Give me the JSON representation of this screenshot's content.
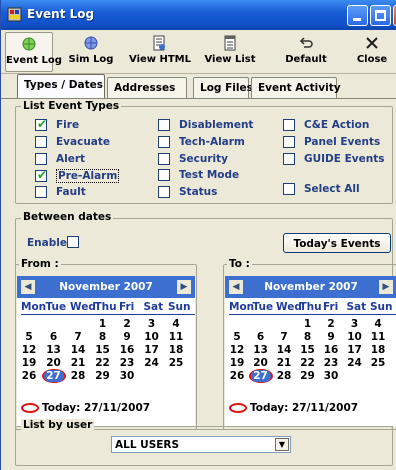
{
  "window": {
    "title": "Event Log",
    "colors": {
      "titlebar": "#1150c8",
      "calendar_header": "#3d6fd0",
      "highlight": "#e01010",
      "label_blue": "#223e86"
    }
  },
  "toolbar": [
    {
      "label": "Event Log",
      "icon": "green-circle-icon"
    },
    {
      "label": "Sim Log",
      "icon": "blue-circle-icon"
    },
    {
      "label": "View HTML",
      "icon": "html-doc-icon"
    },
    {
      "label": "View List",
      "icon": "list-doc-icon"
    },
    {
      "label": "Default",
      "icon": "undo-arrow-icon"
    },
    {
      "label": "Close",
      "icon": "x-close-icon"
    }
  ],
  "tabs": [
    "Types / Dates",
    "Addresses",
    "Log Files",
    "Event Activity"
  ],
  "event_types": {
    "title": "List Event Types",
    "items": [
      {
        "label": "Fire",
        "checked": true
      },
      {
        "label": "Evacuate",
        "checked": false
      },
      {
        "label": "Alert",
        "checked": false
      },
      {
        "label": "Pre-Alarm",
        "checked": true
      },
      {
        "label": "Fault",
        "checked": false
      },
      {
        "label": "Disablement",
        "checked": false
      },
      {
        "label": "Tech-Alarm",
        "checked": false
      },
      {
        "label": "Security",
        "checked": false
      },
      {
        "label": "Test Mode",
        "checked": false
      },
      {
        "label": "Status",
        "checked": false
      },
      {
        "label": "C&E Action",
        "checked": false
      },
      {
        "label": "Panel Events",
        "checked": false
      },
      {
        "label": "GUIDE Events",
        "checked": false
      },
      {
        "label": "Select All",
        "checked": false
      }
    ]
  },
  "between_dates": {
    "title": "Between dates",
    "enable_label": "Enable",
    "todays_button": "Today's Events",
    "from_label": "From :",
    "to_label": "To :"
  },
  "calendar": {
    "month": "November 2007",
    "dow": [
      "Mon",
      "Tue",
      "Wed",
      "Thu",
      "Fri",
      "Sat",
      "Sun"
    ],
    "weeks": [
      [
        "",
        "",
        "",
        "1",
        "2",
        "3",
        "4"
      ],
      [
        "5",
        "6",
        "7",
        "8",
        "9",
        "10",
        "11"
      ],
      [
        "12",
        "13",
        "14",
        "15",
        "16",
        "17",
        "18"
      ],
      [
        "19",
        "20",
        "21",
        "22",
        "23",
        "24",
        "25"
      ],
      [
        "26",
        "27",
        "28",
        "29",
        "30",
        "",
        ""
      ]
    ],
    "selected": "27",
    "today_text": "Today: 27/11/2007"
  },
  "user_filter": {
    "title": "List by user",
    "value": "ALL USERS"
  }
}
